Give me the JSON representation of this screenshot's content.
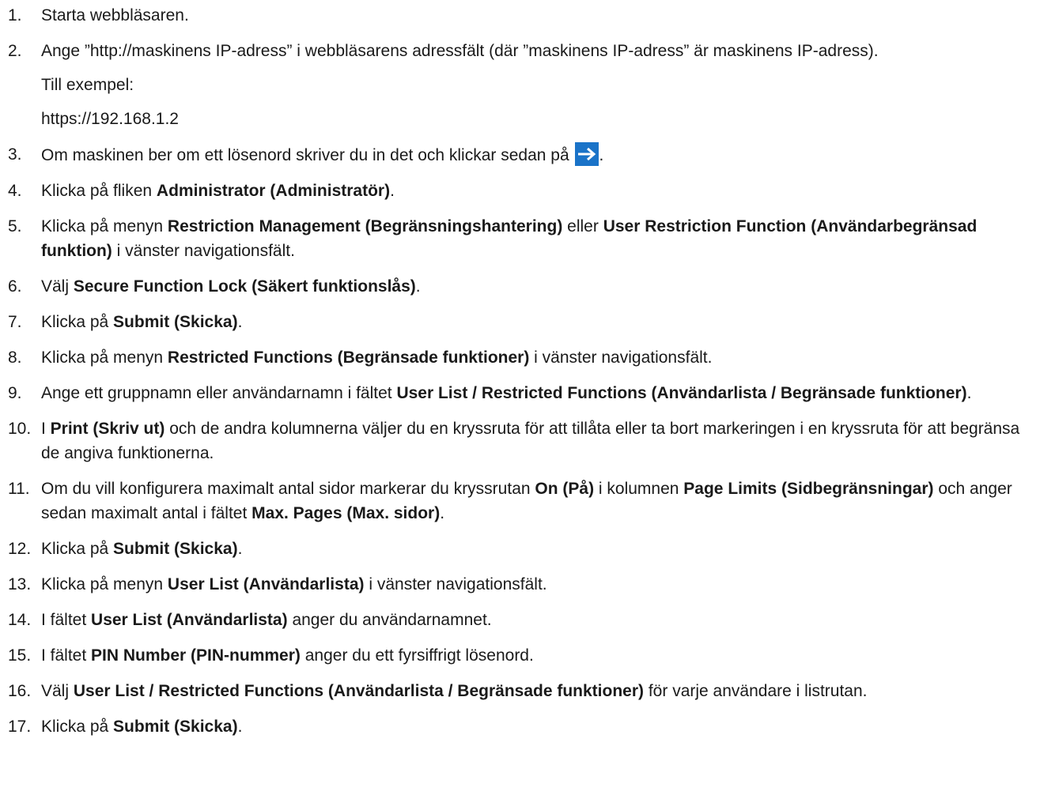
{
  "steps": [
    {
      "num": "1.",
      "parts": [
        "Starta webbläsaren."
      ]
    },
    {
      "num": "2.",
      "parts": [
        "Ange ”http://maskinens IP-adress” i webbläsarens adressfält (där ”maskinens IP-adress” är maskinens IP-adress)."
      ],
      "example_label": "Till exempel:",
      "example_value": "https://192.168.1.2"
    },
    {
      "num": "3.",
      "parts": [
        "Om maskinen ber om ett lösenord skriver du in det och klickar sedan på ",
        "."
      ]
    },
    {
      "num": "4.",
      "parts": [
        "Klicka på fliken ",
        "Administrator (Administratör)",
        "."
      ]
    },
    {
      "num": "5.",
      "parts": [
        "Klicka på menyn ",
        "Restriction Management (Begränsningshantering)",
        " eller ",
        "User Restriction Function (Användarbegränsad funktion)",
        " i vänster navigationsfält."
      ]
    },
    {
      "num": "6.",
      "parts": [
        "Välj ",
        "Secure Function Lock (Säkert funktionslås)",
        "."
      ]
    },
    {
      "num": "7.",
      "parts": [
        "Klicka på ",
        "Submit (Skicka)",
        "."
      ]
    },
    {
      "num": "8.",
      "parts": [
        "Klicka på menyn ",
        "Restricted Functions (Begränsade funktioner)",
        " i vänster navigationsfält."
      ]
    },
    {
      "num": "9.",
      "parts": [
        "Ange ett gruppnamn eller användarnamn i fältet ",
        "User List / Restricted Functions (Användarlista / Begränsade funktioner)",
        "."
      ]
    },
    {
      "num": "10.",
      "parts": [
        "I ",
        "Print (Skriv ut)",
        " och de andra kolumnerna väljer du en kryssruta för att tillåta eller ta bort markeringen i en kryssruta för att begränsa de angiva funktionerna."
      ]
    },
    {
      "num": "11.",
      "parts": [
        "Om du vill konfigurera maximalt antal sidor markerar du kryssrutan ",
        "On (På)",
        " i kolumnen ",
        "Page Limits (Sidbegränsningar)",
        " och anger sedan maximalt antal i fältet ",
        "Max. Pages (Max. sidor)",
        "."
      ]
    },
    {
      "num": "12.",
      "parts": [
        "Klicka på ",
        "Submit (Skicka)",
        "."
      ]
    },
    {
      "num": "13.",
      "parts": [
        "Klicka på menyn ",
        "User List (Användarlista)",
        " i vänster navigationsfält."
      ]
    },
    {
      "num": "14.",
      "parts": [
        "I fältet ",
        "User List (Användarlista)",
        " anger du användarnamnet."
      ]
    },
    {
      "num": "15.",
      "parts": [
        "I fältet ",
        "PIN Number (PIN-nummer)",
        " anger du ett fyrsiffrigt lösenord."
      ]
    },
    {
      "num": "16.",
      "parts": [
        "Välj ",
        "User List / Restricted Functions (Användarlista / Begränsade funktioner)",
        " för varje användare i listrutan."
      ]
    },
    {
      "num": "17.",
      "parts": [
        "Klicka på ",
        "Submit (Skicka)",
        "."
      ]
    }
  ],
  "icons": {
    "go_arrow": "go-arrow-icon",
    "go_arrow_color": "#1a73c8"
  }
}
